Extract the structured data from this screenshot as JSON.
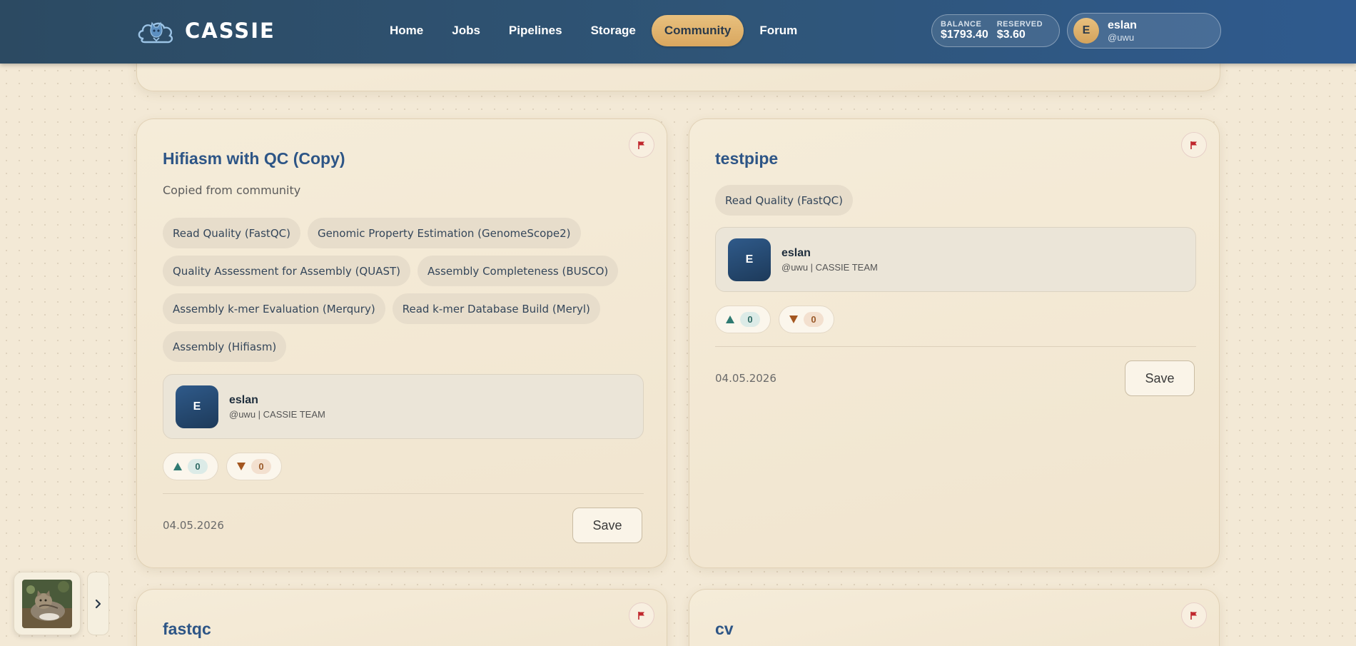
{
  "header": {
    "brand": "CASSIE",
    "nav": [
      {
        "label": "Home",
        "active": false
      },
      {
        "label": "Jobs",
        "active": false
      },
      {
        "label": "Pipelines",
        "active": false
      },
      {
        "label": "Storage",
        "active": false
      },
      {
        "label": "Community",
        "active": true
      },
      {
        "label": "Forum",
        "active": false
      }
    ],
    "balance_label": "BALANCE",
    "balance_value": "$1793.40",
    "reserved_label": "RESERVED",
    "reserved_value": "$3.60",
    "user": {
      "initial": "E",
      "name": "eslan",
      "handle": "@uwu"
    }
  },
  "cards": [
    {
      "title": "Hifiasm with QC (Copy)",
      "description": "Copied from community",
      "tags": [
        "Read Quality (FastQC)",
        "Genomic Property Estimation (GenomeScope2)",
        "Quality Assessment for Assembly (QUAST)",
        "Assembly Completeness (BUSCO)",
        "Assembly k-mer Evaluation (Merqury)",
        "Read k-mer Database Build (Meryl)",
        "Assembly (Hifiasm)"
      ],
      "author": {
        "initial": "E",
        "name": "eslan",
        "meta": "@uwu | CASSIE TEAM"
      },
      "upvotes": "0",
      "downvotes": "0",
      "date": "04.05.2026",
      "save_label": "Save"
    },
    {
      "title": "testpipe",
      "description": "",
      "tags": [
        "Read Quality (FastQC)"
      ],
      "author": {
        "initial": "E",
        "name": "eslan",
        "meta": "@uwu | CASSIE TEAM"
      },
      "upvotes": "0",
      "downvotes": "0",
      "date": "04.05.2026",
      "save_label": "Save"
    },
    {
      "title": "fastqc"
    },
    {
      "title": "cv"
    }
  ],
  "colors": {
    "header_start": "#2c4a62",
    "header_end": "#2f5a8e",
    "accent_gold": "#e0b46c",
    "title_blue": "#2d5586",
    "flag_red": "#c0272d",
    "upvote_teal": "#2f7a72",
    "downvote_brown": "#a4561f"
  },
  "icons": {
    "logo": "cat-cloud-logo",
    "flag": "flag-icon",
    "upvote": "triangle-up-icon",
    "downvote": "triangle-down-icon",
    "expand": "chevron-right-icon"
  }
}
